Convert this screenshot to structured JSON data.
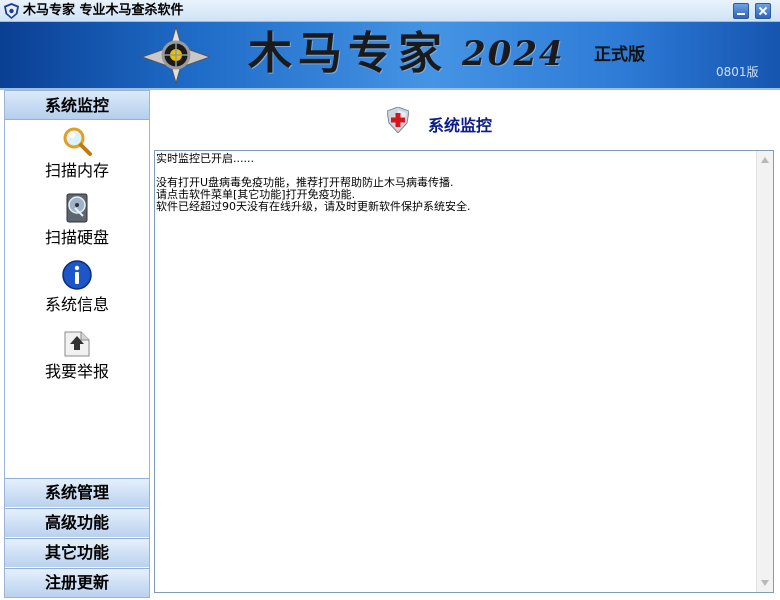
{
  "window": {
    "title": "木马专家  专业木马查杀软件"
  },
  "banner": {
    "brand": "木马专家",
    "year": "2024",
    "edition": "正式版",
    "version": "0801版"
  },
  "sidebar": {
    "active_section": "系统监控",
    "tools": [
      {
        "label": "扫描内存",
        "icon": "magnifier-icon"
      },
      {
        "label": "扫描硬盘",
        "icon": "hard-disk-icon"
      },
      {
        "label": "系统信息",
        "icon": "info-icon"
      },
      {
        "label": "我要举报",
        "icon": "report-upload-icon"
      }
    ],
    "sections": [
      "系统管理",
      "高级功能",
      "其它功能",
      "注册更新"
    ]
  },
  "main": {
    "title": "系统监控",
    "icon": "shield-cross-icon",
    "log_lines": [
      "实时监控已开启......",
      "",
      "没有打开U盘病毒免疫功能，推荐打开帮助防止木马病毒传播.",
      "请点击软件菜单[其它功能]打开免疫功能.",
      "软件已经超过90天没有在线升级，请及时更新软件保护系统安全."
    ]
  },
  "colors": {
    "banner_dark": "#0a3f93",
    "banner_light": "#4594e4",
    "header_title": "#0a1b8a",
    "section_button": "#b9d1ef"
  }
}
